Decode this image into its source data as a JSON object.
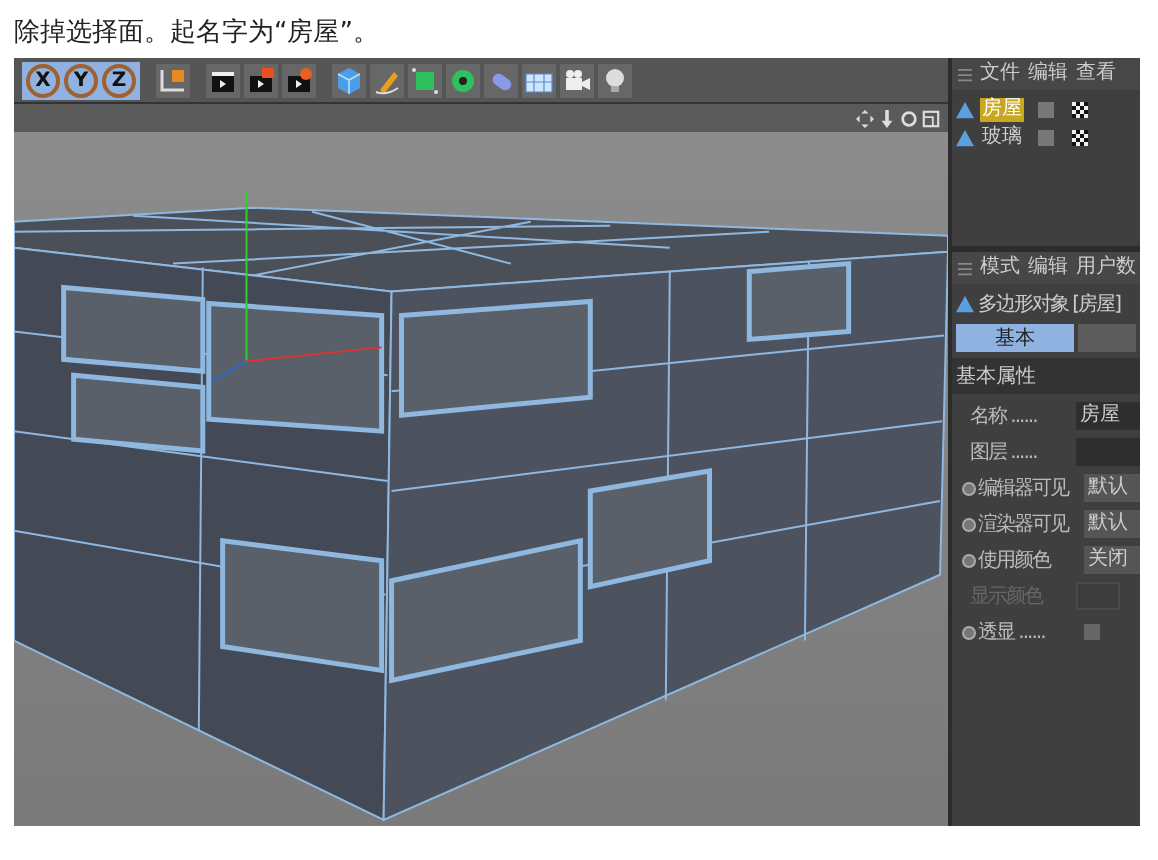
{
  "caption": "除掉选择面。起名字为“房屋”。",
  "toolbar": {
    "axis_buttons": [
      {
        "label": "X",
        "selected": true
      },
      {
        "label": "Y",
        "selected": true
      },
      {
        "label": "Z",
        "selected": true
      }
    ]
  },
  "object_manager": {
    "menu": [
      "文件",
      "编辑",
      "查看"
    ],
    "objects": [
      {
        "name": "房屋",
        "selected": true
      },
      {
        "name": "玻璃",
        "selected": false
      }
    ]
  },
  "attribute_manager": {
    "menu": [
      "模式",
      "编辑",
      "用户数"
    ],
    "object_title": "多边形对象 [房屋]",
    "tabs": [
      {
        "label": "基本",
        "selected": true
      },
      {
        "selected": false
      }
    ],
    "section": "基本属性",
    "properties": [
      {
        "kind": "text",
        "label": "名称 ......",
        "value": "房屋"
      },
      {
        "kind": "text",
        "label": "图层 ......"
      },
      {
        "kind": "select",
        "label": "编辑器可见",
        "value": "默认"
      },
      {
        "kind": "select",
        "label": "渲染器可见",
        "value": "默认"
      },
      {
        "kind": "select",
        "label": "使用颜色",
        "value": "关闭"
      },
      {
        "kind": "color",
        "label": "显示颜色",
        "disabled": true
      },
      {
        "kind": "check",
        "label": "透显 ......",
        "checked": false
      }
    ]
  }
}
